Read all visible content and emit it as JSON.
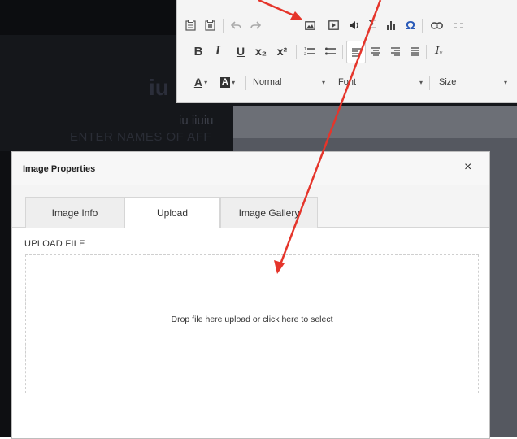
{
  "background_editor": {
    "title": "iu",
    "subtitle": "iu iiuiu",
    "names_placeholder": "ENTER NAMES OF AFF"
  },
  "toolbar": {
    "row1": [
      "template-icon",
      "paste-icon",
      "undo-icon",
      "redo-icon",
      "image-icon",
      "media-icon",
      "audio-icon",
      "sigma-icon",
      "chart-icon",
      "omega-icon",
      "link-icon",
      "unlink-icon"
    ],
    "row2": {
      "bold": "B",
      "italic": "I",
      "underline": "U",
      "subscript": "x₂",
      "superscript": "x²",
      "clear_format": "Iₓ"
    },
    "row3": {
      "text_color": "A",
      "bg_color": "A",
      "format_value": "Normal",
      "font_value": "Font",
      "size_value": "Size"
    }
  },
  "dialog": {
    "title": "Image Properties",
    "close": "×",
    "tabs": [
      {
        "label": "Image Info",
        "active": false
      },
      {
        "label": "Upload",
        "active": true
      },
      {
        "label": "Image Gallery",
        "active": false
      }
    ],
    "upload_label": "UPLOAD FILE",
    "drop_text": "Drop file here upload or click here to select"
  },
  "colors": {
    "annotation_red": "#e5352b",
    "editor_dark": "#15171b",
    "toolbar_bg": "#f4f4f4",
    "omega_blue": "#2a5ab8"
  }
}
